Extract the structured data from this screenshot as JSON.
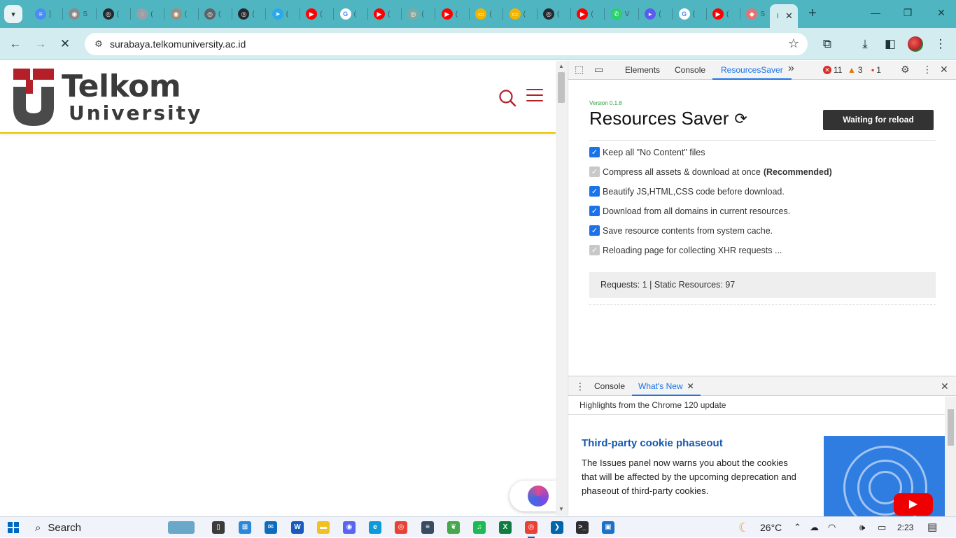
{
  "browser": {
    "tabs": [
      {
        "title": "]",
        "fav_bg": "#4c8bf5",
        "fav_text": "≡",
        "active": false
      },
      {
        "title": "S",
        "fav_bg": "#8a8a8a",
        "fav_text": "◉",
        "active": false
      },
      {
        "title": "(",
        "fav_bg": "#24292f",
        "fav_text": "◎",
        "active": false
      },
      {
        "title": "(",
        "fav_bg": "#9aa0a6",
        "fav_text": "◌",
        "active": false
      },
      {
        "title": "(",
        "fav_bg": "#9b8e7e",
        "fav_text": "◉",
        "active": false
      },
      {
        "title": "(",
        "fav_bg": "#5f6368",
        "fav_text": "◎",
        "active": false
      },
      {
        "title": "(",
        "fav_bg": "#24292f",
        "fav_text": "◎",
        "active": false
      },
      {
        "title": "(",
        "fav_bg": "#29a9eb",
        "fav_text": "➤",
        "active": false
      },
      {
        "title": "(",
        "fav_bg": "#ff0000",
        "fav_text": "▶",
        "active": false
      },
      {
        "title": "(",
        "fav_bg": "#ffffff",
        "fav_text": "G",
        "active": false
      },
      {
        "title": "(",
        "fav_bg": "#ff0000",
        "fav_text": "▶",
        "active": false
      },
      {
        "title": "(",
        "fav_bg": "#7fa8a0",
        "fav_text": "◎",
        "active": false
      },
      {
        "title": "(",
        "fav_bg": "#ff0000",
        "fav_text": "▶",
        "active": false
      },
      {
        "title": "(",
        "fav_bg": "#f4b400",
        "fav_text": "▭",
        "active": false
      },
      {
        "title": "(",
        "fav_bg": "#f4b400",
        "fav_text": "▭",
        "active": false
      },
      {
        "title": "(",
        "fav_bg": "#24292f",
        "fav_text": "◎",
        "active": false
      },
      {
        "title": "(",
        "fav_bg": "#ff0000",
        "fav_text": "▶",
        "active": false
      },
      {
        "title": "V",
        "fav_bg": "#25d366",
        "fav_text": "✆",
        "active": false
      },
      {
        "title": "(",
        "fav_bg": "#5b5bf0",
        "fav_text": "▸",
        "active": false
      },
      {
        "title": "(",
        "fav_bg": "#ffffff",
        "fav_text": "G",
        "active": false
      },
      {
        "title": "(",
        "fav_bg": "#ff0000",
        "fav_text": "▶",
        "active": false
      },
      {
        "title": "S",
        "fav_bg": "#e57373",
        "fav_text": "◆",
        "active": false
      }
    ],
    "active_tab": {
      "title": "I",
      "close": "✕"
    },
    "new_tab": "+",
    "window": {
      "minimize": "—",
      "restore": "❐",
      "close": "✕"
    },
    "tab_menu": "▾",
    "url": "surabaya.telkomuniversity.ac.id",
    "icons": {
      "back": "←",
      "forward": "→",
      "stop": "✕",
      "site_info": "⚙",
      "bookmark": "☆",
      "extensions": "⧉",
      "download": "⤓",
      "sidebar": "◧",
      "menu": "⋮"
    }
  },
  "site": {
    "logo_line1": "Telkom",
    "logo_line2": "University",
    "brand_red": "#b3202a"
  },
  "devtools": {
    "tabs": [
      "Elements",
      "Console",
      "ResourcesSaver"
    ],
    "active_tab": "ResourcesSaver",
    "more": "»",
    "errors": "11",
    "warnings": "3",
    "issues": "1",
    "icons": {
      "inspect": "⬚",
      "device": "▭",
      "settings": "⚙",
      "menu": "⋮",
      "close": "✕"
    }
  },
  "resources_saver": {
    "version": "Version 0.1.8",
    "title": "Resources Saver",
    "reload_icon": "⟳",
    "button": "Waiting for reload",
    "options": [
      {
        "label": "Keep all \"No Content\" files",
        "checked": true,
        "disabled": false,
        "strong": ""
      },
      {
        "label": "Compress all assets & download at once",
        "checked": true,
        "disabled": true,
        "strong": "(Recommended)"
      },
      {
        "label": "Beautify JS,HTML,CSS code before download.",
        "checked": true,
        "disabled": false,
        "strong": ""
      },
      {
        "label": "Download from all domains in current resources.",
        "checked": true,
        "disabled": false,
        "strong": ""
      },
      {
        "label": "Save resource contents from system cache.",
        "checked": true,
        "disabled": false,
        "strong": ""
      },
      {
        "label": "Reloading page for collecting XHR requests ...",
        "checked": true,
        "disabled": true,
        "strong": ""
      }
    ],
    "status": "Requests: 1 | Static Resources: 97"
  },
  "drawer": {
    "tabs": [
      "Console",
      "What's New"
    ],
    "active_tab": "What's New",
    "tab_close": "✕",
    "menu": "⋮",
    "close": "✕",
    "subtitle": "Highlights from the Chrome 120 update",
    "headline": "Third-party cookie phaseout",
    "body": "The Issues panel now warns you about the cookies that will be affected by the upcoming deprecation and phaseout of third-party cookies.",
    "video_icon": "▶"
  },
  "taskbar": {
    "search": "Search",
    "apps": [
      {
        "name": "wallpaper-widget",
        "bg": "#6aa7c9",
        "txt": ""
      },
      {
        "name": "task-view",
        "bg": "#3b3b3b",
        "txt": "▯"
      },
      {
        "name": "ms-store",
        "bg": "#2b88d8",
        "txt": "⊞"
      },
      {
        "name": "mail",
        "bg": "#0f6cbd",
        "txt": "✉"
      },
      {
        "name": "word",
        "bg": "#185abd",
        "txt": "W"
      },
      {
        "name": "file-explorer",
        "bg": "#f3c020",
        "txt": "▬"
      },
      {
        "name": "discord",
        "bg": "#5865f2",
        "txt": "◉"
      },
      {
        "name": "edge",
        "bg": "#0c9bd8",
        "txt": "e"
      },
      {
        "name": "chrome",
        "bg": "#e94235",
        "txt": "◎"
      },
      {
        "name": "notepad",
        "bg": "#394b5e",
        "txt": "≡"
      },
      {
        "name": "leaf-app",
        "bg": "#46a84a",
        "txt": "❦"
      },
      {
        "name": "spotify",
        "bg": "#1db954",
        "txt": "♫"
      },
      {
        "name": "excel",
        "bg": "#107c41",
        "txt": "X"
      },
      {
        "name": "chrome-active",
        "bg": "#e94235",
        "txt": "◎"
      },
      {
        "name": "vscode",
        "bg": "#0065a9",
        "txt": "❯"
      },
      {
        "name": "terminal",
        "bg": "#2d2d2d",
        "txt": ">_"
      },
      {
        "name": "media-app",
        "bg": "#1a73c8",
        "txt": "▣"
      }
    ],
    "weather": "26°C",
    "weather_icon": "☾",
    "time": "2:23",
    "tray_up": "⌃",
    "tray_cloud": "☁",
    "tray_wifi": "◠",
    "tray_volume": "🕪",
    "tray_battery": "▭",
    "tray_notify": "▤"
  }
}
